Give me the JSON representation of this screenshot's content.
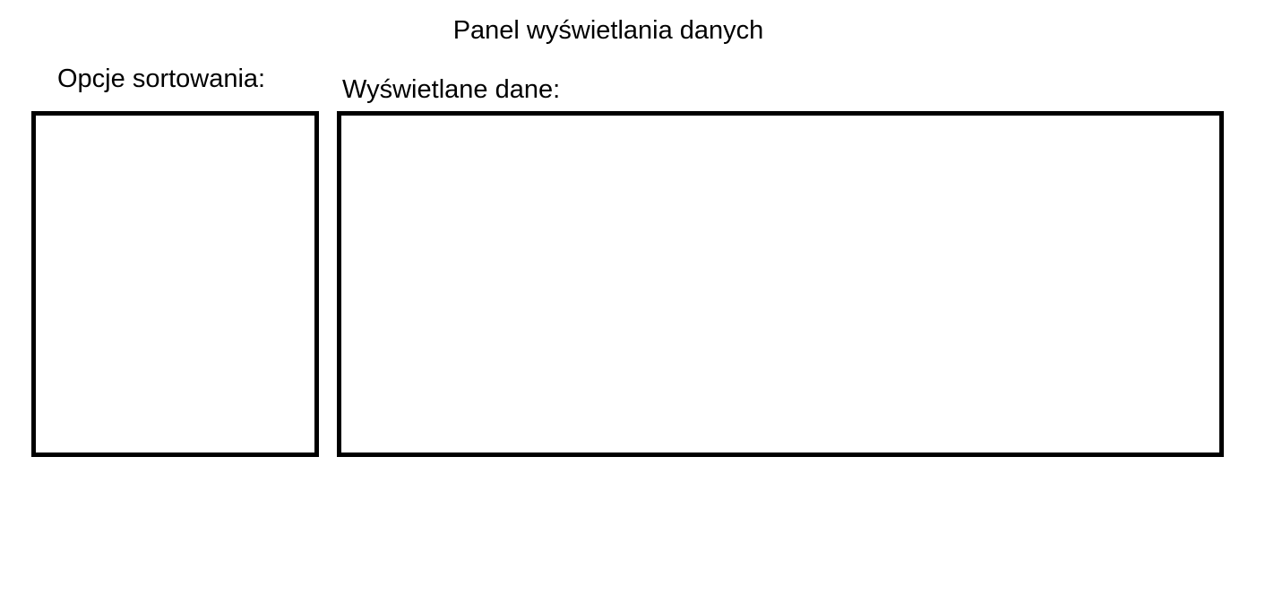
{
  "page": {
    "title": "Panel wyświetlania danych"
  },
  "sort_panel": {
    "label": "Opcje sortowania:"
  },
  "data_panel": {
    "label": "Wyświetlane dane:"
  },
  "colors": {
    "background": "#ffffff",
    "text": "#000000",
    "border": "#000000"
  }
}
